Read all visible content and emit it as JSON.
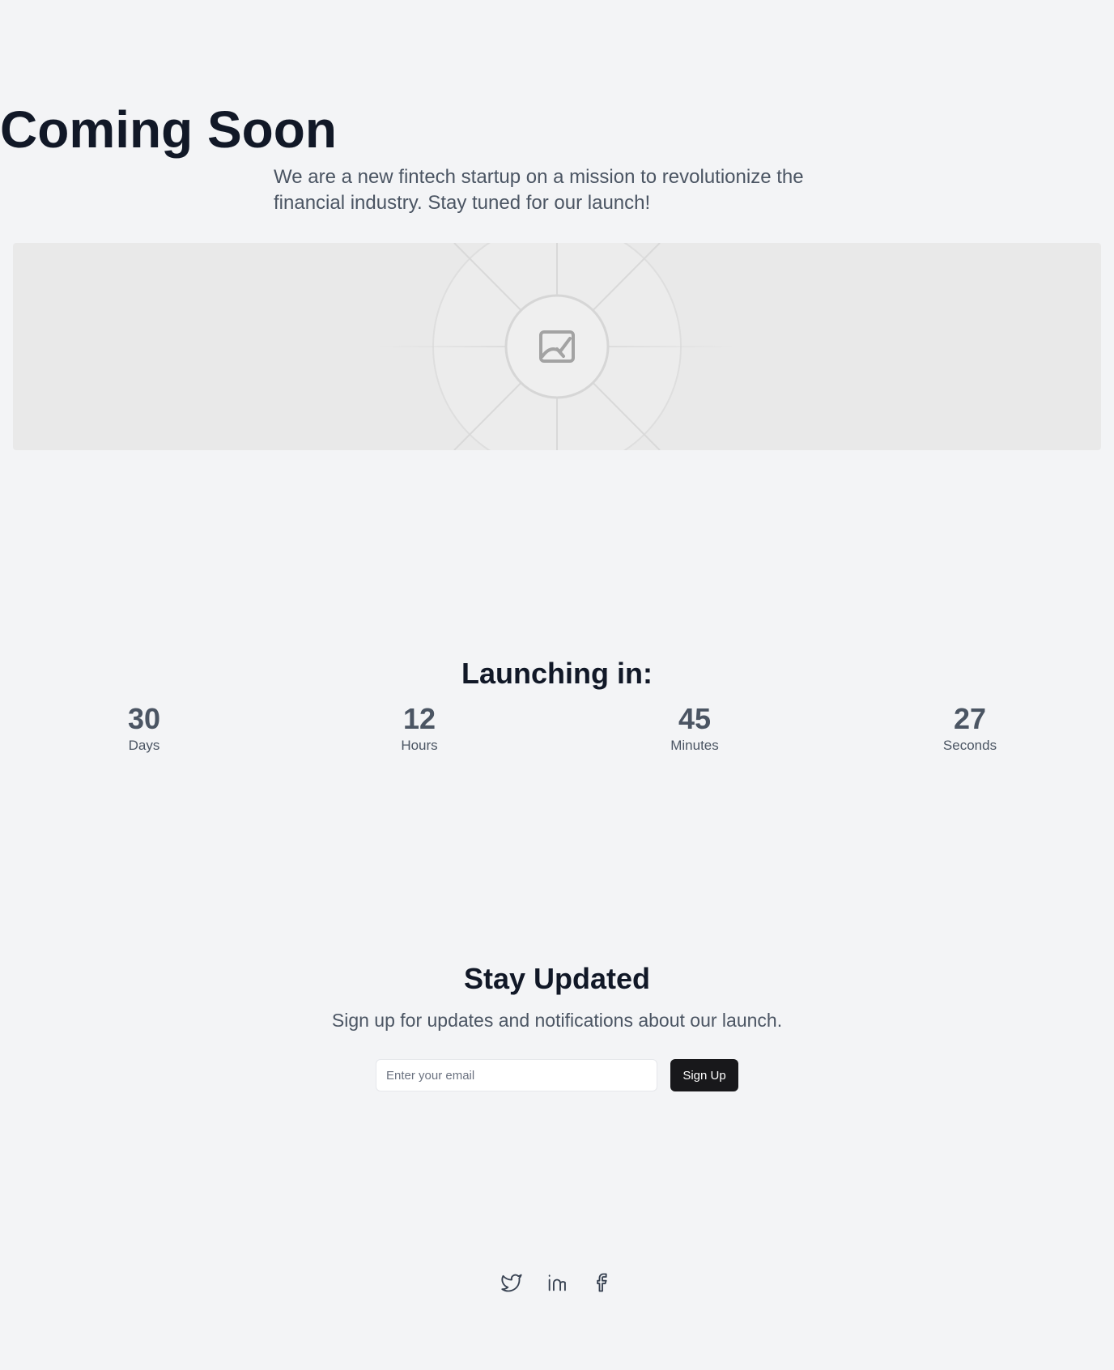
{
  "hero": {
    "title": "Coming Soon",
    "subtitle": "We are a new fintech startup on a mission to revolutionize the financial industry. Stay tuned for our launch!",
    "image_icon": "image-placeholder-icon"
  },
  "countdown": {
    "title": "Launching in:",
    "units": [
      {
        "value": "30",
        "label": "Days"
      },
      {
        "value": "12",
        "label": "Hours"
      },
      {
        "value": "45",
        "label": "Minutes"
      },
      {
        "value": "27",
        "label": "Seconds"
      }
    ]
  },
  "newsletter": {
    "title": "Stay Updated",
    "subtitle": "Sign up for updates and notifications about our launch.",
    "email_placeholder": "Enter your email",
    "email_value": "",
    "button_label": "Sign Up"
  },
  "social": {
    "icons": [
      "twitter-icon",
      "linkedin-icon",
      "facebook-icon"
    ]
  },
  "colors": {
    "background": "#f3f4f6",
    "heading": "#111827",
    "body_text": "#4b5563",
    "button": "#18181b",
    "image_placeholder": "#e9e9e9"
  }
}
